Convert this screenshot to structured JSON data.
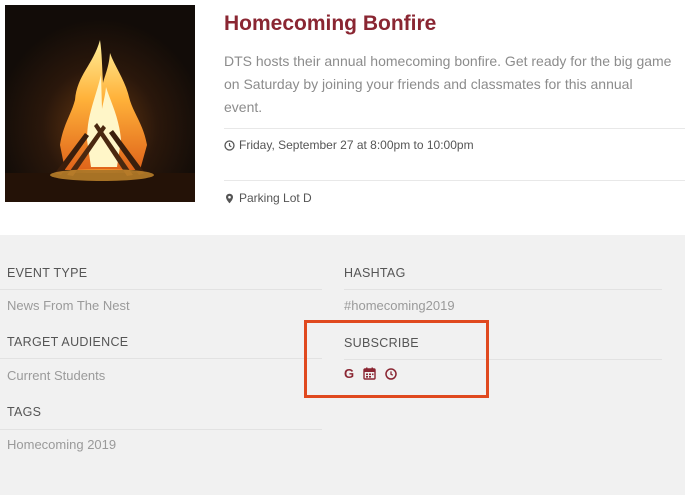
{
  "event": {
    "title": "Homecoming Bonfire",
    "description": "DTS hosts their annual homecoming bonfire. Get ready for the big game on Saturday by joining your friends and classmates for this annual event.",
    "datetime": "Friday, September 27 at 8:00pm to 10:00pm",
    "location": "Parking Lot D",
    "image_icon": "bonfire-photo",
    "accent_color": "#8a2632"
  },
  "details": {
    "event_type": {
      "label": "EVENT TYPE",
      "value": "News From The Nest"
    },
    "target_audience": {
      "label": "TARGET AUDIENCE",
      "value": "Current Students"
    },
    "tags": {
      "label": "TAGS",
      "value": "Homecoming 2019"
    },
    "hashtag": {
      "label": "HASHTAG",
      "value": "#homecoming2019"
    },
    "subscribe": {
      "label": "SUBSCRIBE",
      "google_letter": "G",
      "icons": [
        "google-icon",
        "calendar-icon",
        "outlook-icon"
      ]
    }
  },
  "highlight_color": "#e0491f"
}
